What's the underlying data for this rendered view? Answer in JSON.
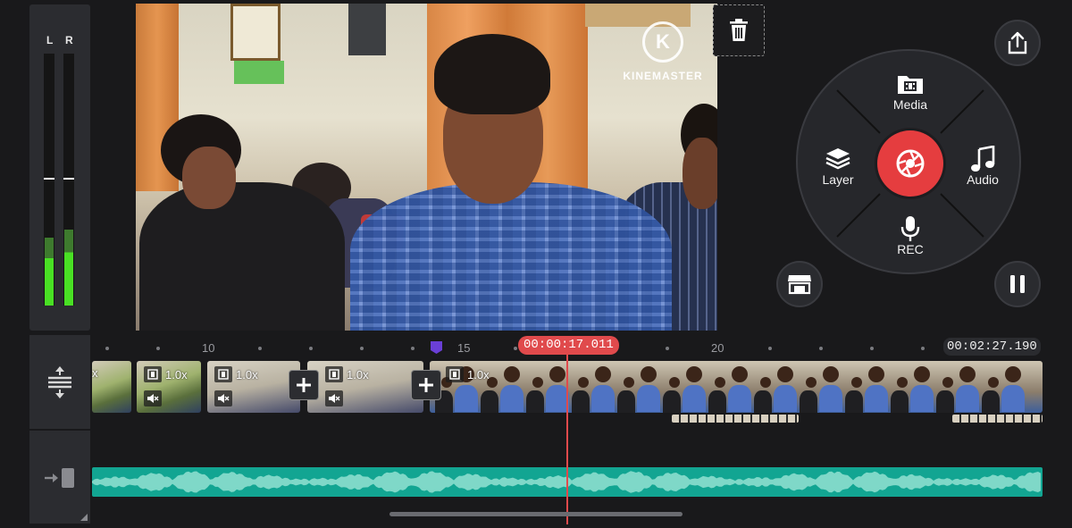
{
  "meter": {
    "left_label": "L",
    "right_label": "R",
    "left_level": 0.17,
    "right_level": 0.19,
    "left_peak": 0.5,
    "right_peak": 0.5
  },
  "preview": {
    "watermark_logo": "K",
    "watermark_text": "KINEMASTER"
  },
  "wheel": {
    "media_label": "Media",
    "layer_label": "Layer",
    "audio_label": "Audio",
    "rec_label": "REC"
  },
  "timeline": {
    "current_time": "00:00:17.011",
    "total_time": "00:02:27.190",
    "ruler_labels": [
      "10",
      "15",
      "20"
    ],
    "clips": [
      {
        "speed": "1.0x"
      },
      {
        "speed": "1.0x"
      },
      {
        "speed": "1.0x"
      },
      {
        "speed": "1.0x"
      }
    ],
    "first_clip_partial_text": "x"
  },
  "icons": {
    "trash": "trash-icon",
    "share": "share-icon",
    "store": "store-icon",
    "pause": "pause-icon",
    "record": "camera-shutter-icon",
    "media": "folder-film-icon",
    "layer": "layers-icon",
    "audio": "music-note-icon",
    "rec": "microphone-icon",
    "track_height": "track-height-icon",
    "audio_track_toggle": "track-enter-icon",
    "bookmark": "bookmark-icon",
    "film": "film-icon",
    "mute": "mute-icon",
    "add": "plus-icon"
  },
  "colors": {
    "accent_red": "#e04a4c",
    "audio_track": "#12a592",
    "meter_green": "#49e024",
    "bookmark_purple": "#6a3fd6"
  }
}
